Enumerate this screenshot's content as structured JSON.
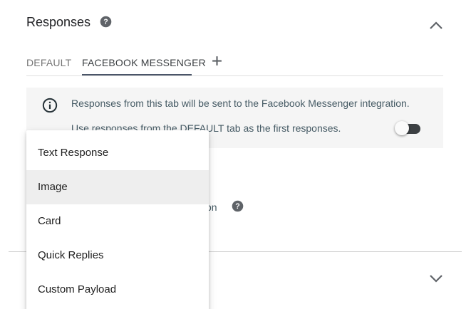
{
  "section": {
    "title": "Responses",
    "help_icon": "help-circle-icon",
    "collapse_icon": "chevron-up-icon",
    "expand_icon": "chevron-down-icon"
  },
  "tabs": [
    {
      "label": "DEFAULT",
      "selected": false
    },
    {
      "label": "FACEBOOK MESSENGER",
      "selected": true
    }
  ],
  "add_tab_icon": "plus-icon",
  "info": {
    "icon": "info-icon",
    "message": "Responses from this tab will be sent to the Facebook Messenger integration.",
    "toggle_label": "Use responses from the DEFAULT tab as the first responses.",
    "toggle_on": false
  },
  "partial_label": "on",
  "menu": {
    "items": [
      {
        "label": "Text Response",
        "highlighted": false
      },
      {
        "label": "Image",
        "highlighted": true
      },
      {
        "label": "Card",
        "highlighted": false
      },
      {
        "label": "Quick Replies",
        "highlighted": false
      },
      {
        "label": "Custom Payload",
        "highlighted": false
      }
    ]
  },
  "colors": {
    "text_secondary": "#455a64",
    "tab_underline": "#4a5568",
    "info_background": "#f5f5f5",
    "menu_highlight": "#eeeeee"
  }
}
